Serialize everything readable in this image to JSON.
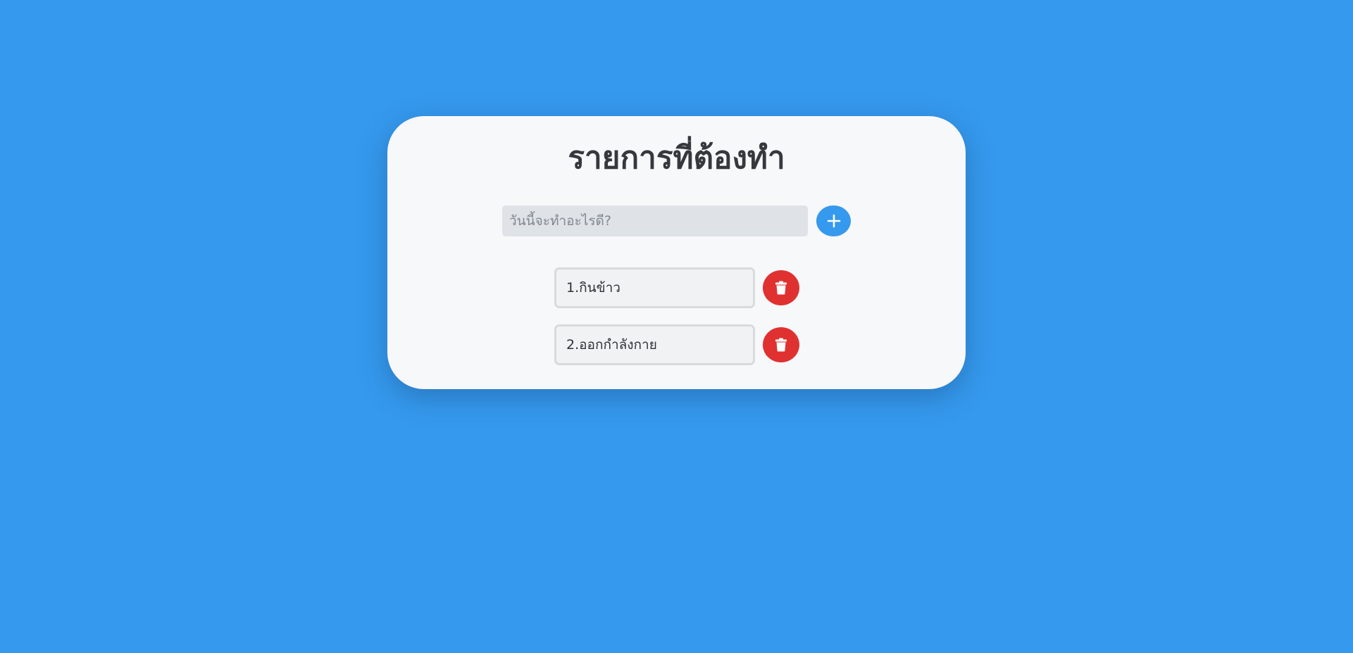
{
  "app": {
    "title": "รายการที่ต้องทำ"
  },
  "add_form": {
    "placeholder": "วันนี้จะทำอะไรดี?",
    "value": "",
    "add_icon": "plus-icon"
  },
  "todos": [
    {
      "label": "1.กินข้าว",
      "delete_icon": "trash-icon"
    },
    {
      "label": "2.ออกกำลังกาย",
      "delete_icon": "trash-icon"
    }
  ],
  "colors": {
    "background": "#3599ed",
    "card": "#f7f8fa",
    "accent": "#3599ed",
    "danger": "#e03131",
    "title_text": "#37383d"
  }
}
